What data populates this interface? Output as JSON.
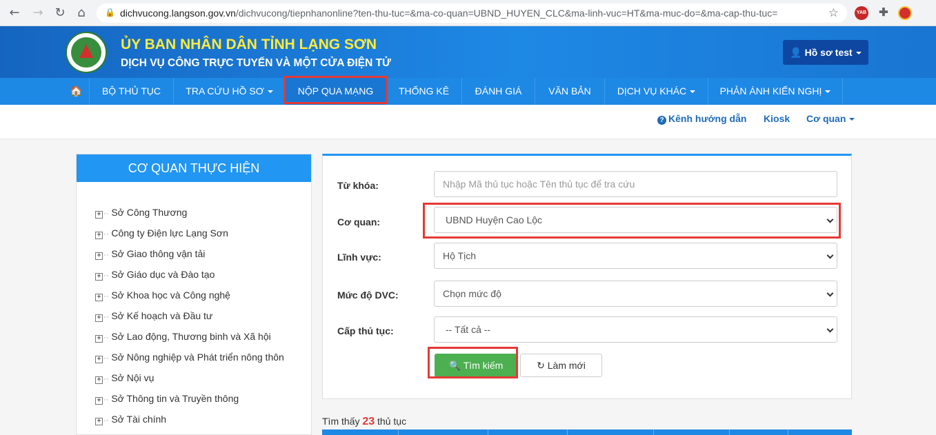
{
  "browser": {
    "url_host": "dichvucong.langson.gov.vn",
    "url_path": "/dichvucong/tiepnhanonline?ten-thu-tuc=&ma-co-quan=UBND_HUYEN_CLC&ma-linh-vuc=HT&ma-muc-do=&ma-cap-thu-tuc=",
    "ext_label": "YAB"
  },
  "header": {
    "logo_text": "LẠNG SƠN",
    "title": "ỦY BAN NHÂN DÂN TỈNH LẠNG SƠN",
    "subtitle": "DỊCH VỤ CÔNG TRỰC TUYẾN VÀ MỘT CỬA ĐIỆN TỬ",
    "profile_label": "Hồ sơ test"
  },
  "nav": {
    "items": [
      {
        "label": "BỘ THỦ TỤC"
      },
      {
        "label": "TRA CỨU HỒ SƠ"
      },
      {
        "label": "NỘP QUA MẠNG"
      },
      {
        "label": "THỐNG KÊ"
      },
      {
        "label": "ĐÁNH GIÁ"
      },
      {
        "label": "VĂN BẢN"
      },
      {
        "label": "DỊCH VỤ KHÁC"
      },
      {
        "label": "PHẢN ÁNH KIẾN NGHỊ"
      }
    ]
  },
  "util": {
    "guide": "Kênh hướng dẫn",
    "kiosk": "Kiosk",
    "agency": "Cơ quan"
  },
  "left_panel": {
    "title": "CƠ QUAN THỰC HIỆN",
    "items": [
      "Sở Công Thương",
      "Công ty Điện lực Lạng Sơn",
      "Sở Giao thông vận tải",
      "Sở Giáo dục và Đào tạo",
      "Sở Khoa học và Công nghệ",
      "Sở Kế hoạch và Đầu tư",
      "Sở Lao động, Thương binh và Xã hội",
      "Sở Nông nghiệp và Phát triển nông thôn",
      "Sở Nội vụ",
      "Sở Thông tin và Truyền thông",
      "Sở Tài chính"
    ]
  },
  "form": {
    "keyword_label": "Từ khóa:",
    "keyword_placeholder": "Nhập Mã thủ tục hoặc Tên thủ tục để tra cứu",
    "agency_label": "Cơ quan:",
    "agency_value": "UBND Huyện Cao Lộc",
    "field_label": "Lĩnh vực:",
    "field_value": "Hộ Tịch",
    "level_label": "Mức độ DVC:",
    "level_value": "Chọn mức độ",
    "tier_label": "Cấp thủ tục:",
    "tier_value": "-- Tất cả --",
    "search_label": "Tìm kiếm",
    "reset_label": "Làm mới"
  },
  "result": {
    "prefix": "Tìm thấy",
    "count": "23",
    "suffix": "thủ tục"
  },
  "colors": {
    "header_blue": "#1e88e5",
    "title_yellow": "#ffeb3b",
    "highlight_red": "#e53935",
    "search_green": "#4caf50"
  }
}
